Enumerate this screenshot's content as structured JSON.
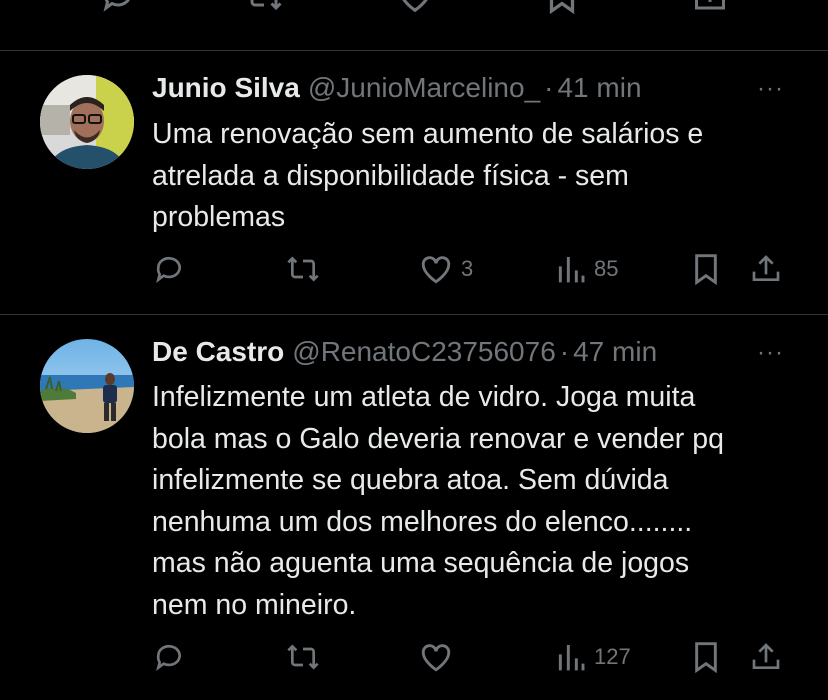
{
  "tweets": [
    {
      "name": "Junio Silva",
      "handle": "@JunioMarcelino_",
      "separator": "·",
      "time": "41 min",
      "more": "···",
      "lines": [
        "Uma renovação sem aumento de salários e",
        "atrelada a disponibilidade física - sem",
        "problemas"
      ],
      "likes": "3",
      "views": "85"
    },
    {
      "name": "De Castro",
      "handle": "@RenatoC23756076",
      "separator": "·",
      "time": "47 min",
      "more": "···",
      "lines": [
        "Infelizmente um atleta de vidro. Joga muita",
        "bola mas o Galo deveria renovar e vender pq",
        "infelizmente se quebra atoa. Sem dúvida",
        "nenhuma um dos melhores do elenco........",
        "mas não aguenta uma sequência de jogos",
        "nem no mineiro."
      ],
      "likes": "",
      "views": "127"
    }
  ],
  "icons": {
    "reply": "reply-icon",
    "retweet": "retweet-icon",
    "like": "heart-icon",
    "views": "views-icon",
    "bookmark": "bookmark-icon",
    "share": "share-icon"
  },
  "colors": {
    "background": "#000000",
    "text": "#e7e9ea",
    "secondary": "#71767b",
    "divider": "#2f3336"
  }
}
